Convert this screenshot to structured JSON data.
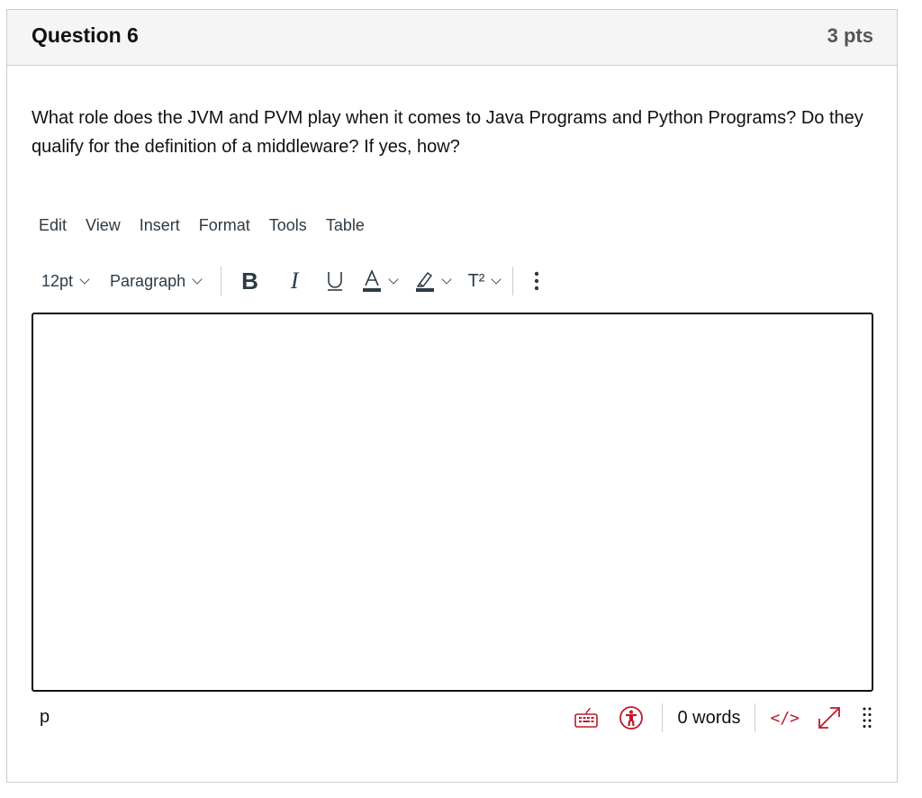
{
  "question": {
    "title": "Question 6",
    "points": "3 pts",
    "text": "What role does the JVM and PVM play when it comes to Java Programs and Python Programs? Do they qualify for the definition of a middleware? If yes, how?"
  },
  "editor": {
    "menubar": [
      "Edit",
      "View",
      "Insert",
      "Format",
      "Tools",
      "Table"
    ],
    "font_size": "12pt",
    "block_format": "Paragraph",
    "toolbar_icons": [
      "bold-icon",
      "italic-icon",
      "underline-icon",
      "text-color-icon",
      "highlight-icon",
      "superscript-icon",
      "more-icon"
    ],
    "bold_label": "B",
    "italic_label": "I",
    "superscript_label": "T²",
    "content": "",
    "status": {
      "path": "p",
      "word_count": "0 words",
      "html_label": "</>"
    },
    "accent_color": "#c0182d"
  }
}
